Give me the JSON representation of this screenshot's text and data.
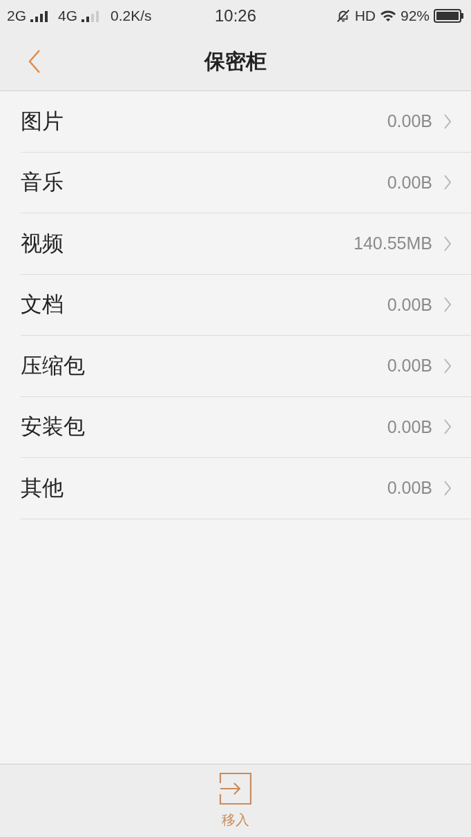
{
  "status_bar": {
    "sim1": "2G",
    "sim2": "4G",
    "speed": "0.2K/s",
    "time": "10:26",
    "hd": "HD",
    "battery": "92%"
  },
  "header": {
    "title": "保密柜"
  },
  "items": [
    {
      "label": "图片",
      "size": "0.00B"
    },
    {
      "label": "音乐",
      "size": "0.00B"
    },
    {
      "label": "视频",
      "size": "140.55MB"
    },
    {
      "label": "文档",
      "size": "0.00B"
    },
    {
      "label": "压缩包",
      "size": "0.00B"
    },
    {
      "label": "安装包",
      "size": "0.00B"
    },
    {
      "label": "其他",
      "size": "0.00B"
    }
  ],
  "bottom_bar": {
    "action": "移入"
  }
}
